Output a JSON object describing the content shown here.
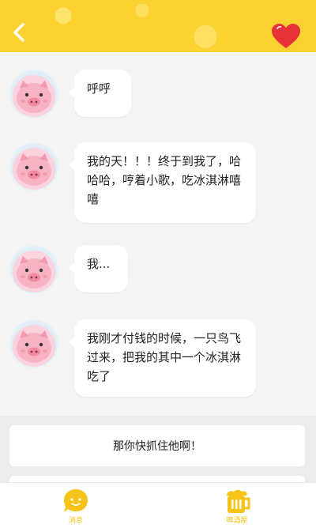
{
  "header": {
    "back_icon": "chevron-left-icon",
    "favorite_icon": "heart-icon",
    "background_color": "#fcd230",
    "heart_color": "#e8323a"
  },
  "messages": [
    {
      "sender": "pig",
      "text": "呼呼"
    },
    {
      "sender": "pig",
      "text": "我的天！！！终于到我了，哈哈哈，哼着小歌，吃冰淇淋嘻嘻"
    },
    {
      "sender": "pig",
      "text": "我..."
    },
    {
      "sender": "pig",
      "text": "我刚才付钱的时候，一只鸟飞过来，把我的其中一个冰淇淋吃了"
    }
  ],
  "reply_options": [
    {
      "text": "那你快抓住他啊！"
    }
  ],
  "tabbar": {
    "tabs": [
      {
        "label": "消息",
        "icon": "chat-face-icon"
      },
      {
        "label": "啤酒屋",
        "icon": "beer-mug-icon"
      }
    ],
    "accent_color": "#f6c419"
  }
}
